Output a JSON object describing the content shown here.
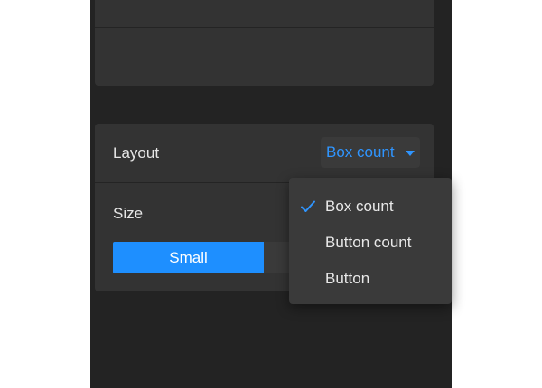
{
  "layout": {
    "label": "Layout",
    "selected": "Box count",
    "options": [
      {
        "label": "Box count",
        "checked": true
      },
      {
        "label": "Button count",
        "checked": false
      },
      {
        "label": "Button",
        "checked": false
      }
    ]
  },
  "size": {
    "label": "Size",
    "options": [
      {
        "label": "Small",
        "active": true
      },
      {
        "label": "",
        "active": false
      }
    ]
  },
  "colors": {
    "panel_bg": "#232323",
    "card_bg": "#333333",
    "accent": "#1e8fff",
    "accent_text": "#2f95ff",
    "text": "#e6e6e6"
  },
  "icons": {
    "select_caret": "caret-down-icon",
    "selected_check": "check-icon"
  }
}
